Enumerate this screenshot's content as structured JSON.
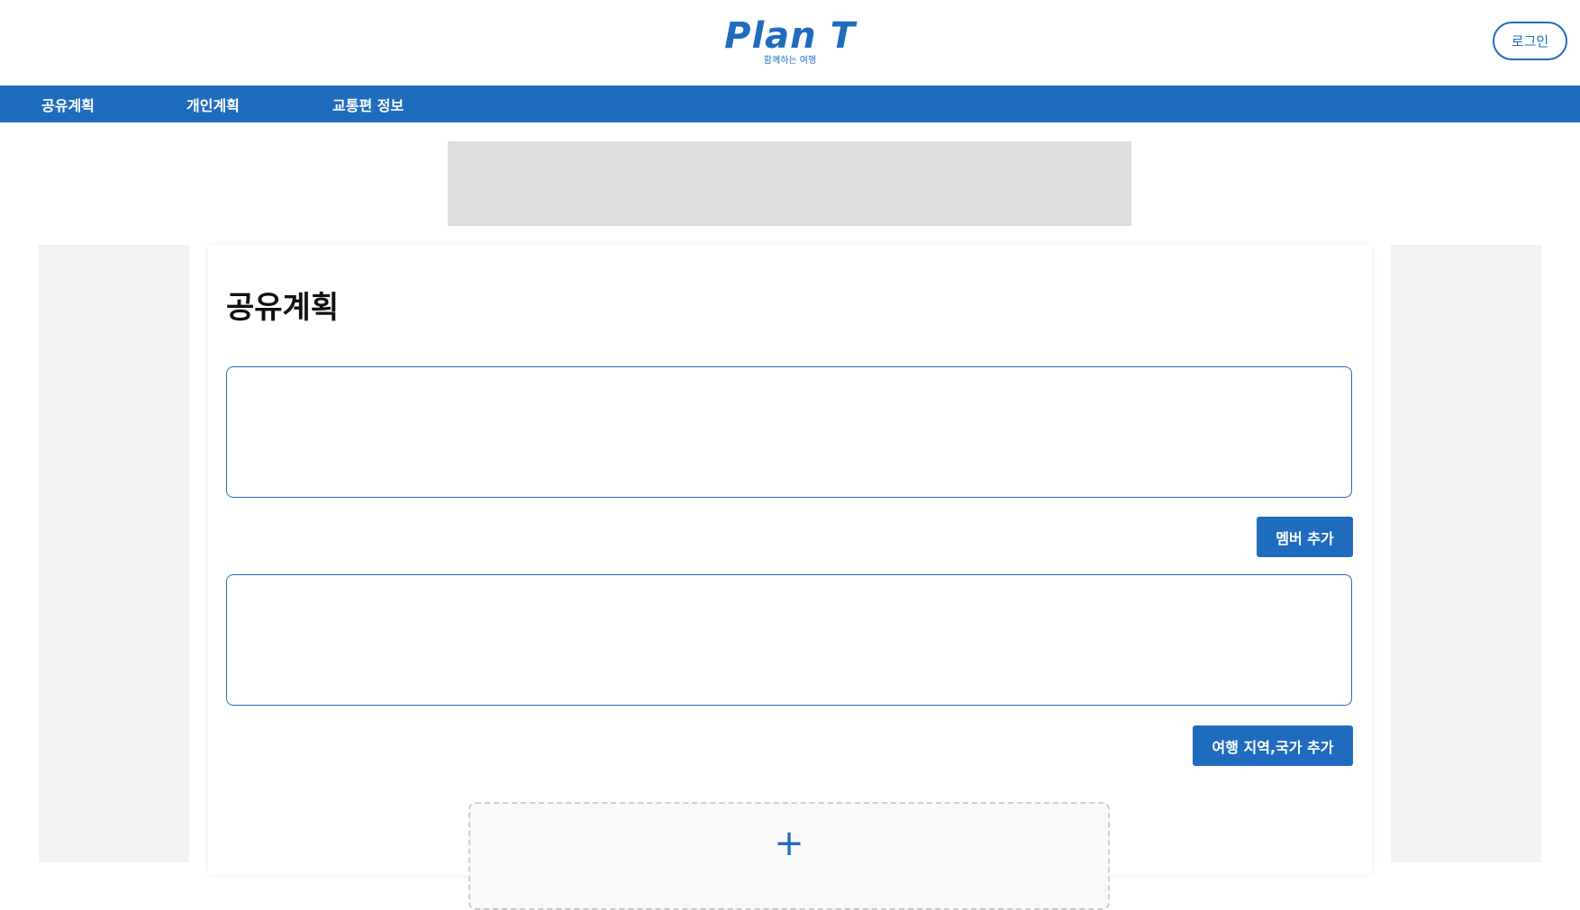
{
  "header": {
    "logo_title": "Plan T",
    "logo_subtitle": "함께하는 여행",
    "login_label": "로그인"
  },
  "nav": {
    "items": [
      {
        "label": "공유계획"
      },
      {
        "label": "개인계획"
      },
      {
        "label": "교통편 정보"
      }
    ]
  },
  "main": {
    "title": "공유계획",
    "member_field": {
      "value": "",
      "placeholder": ""
    },
    "add_member_label": "멤버 추가",
    "region_field": {
      "value": "",
      "placeholder": ""
    },
    "add_region_label": "여행 지역,국가 추가",
    "add_plan_icon": "+"
  },
  "colors": {
    "brand": "#1f6cbf",
    "banner_placeholder": "#dedede",
    "side_placeholder": "#f2f2f2"
  }
}
